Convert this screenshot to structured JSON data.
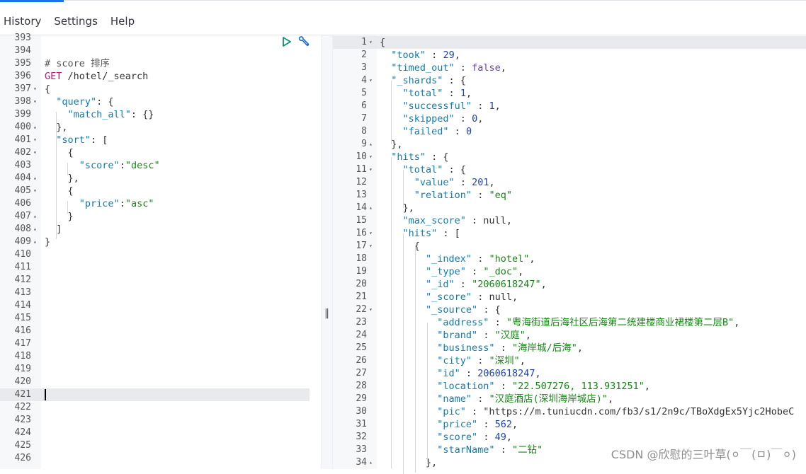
{
  "menu": {
    "history": "History",
    "settings": "Settings",
    "help": "Help"
  },
  "left_editor": {
    "lines": [
      {
        "n": "393",
        "text": ""
      },
      {
        "n": "394",
        "text": ""
      },
      {
        "n": "395",
        "text": "# score 排序"
      },
      {
        "n": "396",
        "text": "GET /hotel/_search"
      },
      {
        "n": "397",
        "text": "{",
        "fold": "▾"
      },
      {
        "n": "398",
        "text": "  \"query\": {",
        "fold": "▾"
      },
      {
        "n": "399",
        "text": "    \"match_all\": {}"
      },
      {
        "n": "400",
        "text": "  },",
        "fold": "▴"
      },
      {
        "n": "401",
        "text": "  \"sort\": [",
        "fold": "▾"
      },
      {
        "n": "402",
        "text": "    {",
        "fold": "▾"
      },
      {
        "n": "403",
        "text": "      \"score\":\"desc\""
      },
      {
        "n": "404",
        "text": "    },",
        "fold": "▴"
      },
      {
        "n": "405",
        "text": "    {",
        "fold": "▾"
      },
      {
        "n": "406",
        "text": "      \"price\":\"asc\""
      },
      {
        "n": "407",
        "text": "    }",
        "fold": "▴"
      },
      {
        "n": "408",
        "text": "  ]",
        "fold": "▴"
      },
      {
        "n": "409",
        "text": "}",
        "fold": "▴"
      },
      {
        "n": "410",
        "text": ""
      },
      {
        "n": "411",
        "text": ""
      },
      {
        "n": "412",
        "text": ""
      },
      {
        "n": "413",
        "text": ""
      },
      {
        "n": "414",
        "text": ""
      },
      {
        "n": "415",
        "text": ""
      },
      {
        "n": "416",
        "text": ""
      },
      {
        "n": "417",
        "text": ""
      },
      {
        "n": "418",
        "text": ""
      },
      {
        "n": "419",
        "text": ""
      },
      {
        "n": "420",
        "text": ""
      },
      {
        "n": "421",
        "text": ""
      },
      {
        "n": "422",
        "text": ""
      },
      {
        "n": "423",
        "text": ""
      },
      {
        "n": "424",
        "text": ""
      },
      {
        "n": "425",
        "text": ""
      },
      {
        "n": "426",
        "text": ""
      }
    ]
  },
  "right_editor": {
    "lines": [
      {
        "n": "1",
        "text": "{",
        "fold": "▾"
      },
      {
        "n": "2",
        "text": "  \"took\" : 29,"
      },
      {
        "n": "3",
        "text": "  \"timed_out\" : false,"
      },
      {
        "n": "4",
        "text": "  \"_shards\" : {",
        "fold": "▾"
      },
      {
        "n": "5",
        "text": "    \"total\" : 1,"
      },
      {
        "n": "6",
        "text": "    \"successful\" : 1,"
      },
      {
        "n": "7",
        "text": "    \"skipped\" : 0,"
      },
      {
        "n": "8",
        "text": "    \"failed\" : 0"
      },
      {
        "n": "9",
        "text": "  },",
        "fold": "▴"
      },
      {
        "n": "10",
        "text": "  \"hits\" : {",
        "fold": "▾"
      },
      {
        "n": "11",
        "text": "    \"total\" : {",
        "fold": "▾"
      },
      {
        "n": "12",
        "text": "      \"value\" : 201,"
      },
      {
        "n": "13",
        "text": "      \"relation\" : \"eq\""
      },
      {
        "n": "14",
        "text": "    },",
        "fold": "▴"
      },
      {
        "n": "15",
        "text": "    \"max_score\" : null,"
      },
      {
        "n": "16",
        "text": "    \"hits\" : [",
        "fold": "▾"
      },
      {
        "n": "17",
        "text": "      {",
        "fold": "▾"
      },
      {
        "n": "18",
        "text": "        \"_index\" : \"hotel\","
      },
      {
        "n": "19",
        "text": "        \"_type\" : \"_doc\","
      },
      {
        "n": "20",
        "text": "        \"_id\" : \"2060618247\","
      },
      {
        "n": "21",
        "text": "        \"_score\" : null,"
      },
      {
        "n": "22",
        "text": "        \"_source\" : {",
        "fold": "▾"
      },
      {
        "n": "23",
        "text": "          \"address\" : \"粤海街道后海社区后海第二统建楼商业裙楼第二层B\","
      },
      {
        "n": "24",
        "text": "          \"brand\" : \"汉庭\","
      },
      {
        "n": "25",
        "text": "          \"business\" : \"海岸城/后海\","
      },
      {
        "n": "26",
        "text": "          \"city\" : \"深圳\","
      },
      {
        "n": "27",
        "text": "          \"id\" : 2060618247,"
      },
      {
        "n": "28",
        "text": "          \"location\" : \"22.507276, 113.931251\","
      },
      {
        "n": "29",
        "text": "          \"name\" : \"汉庭酒店(深圳海岸城店)\","
      },
      {
        "n": "30",
        "text": "          \"pic\" : \"https://m.tuniucdn.com/fb3/s1/2n9c/TBoXdgEx5Yjc2HobeC"
      },
      {
        "n": "31",
        "text": "          \"price\" : 562,"
      },
      {
        "n": "32",
        "text": "          \"score\" : 49,"
      },
      {
        "n": "33",
        "text": "          \"starName\" : \"二钻\""
      },
      {
        "n": "34",
        "text": "        },",
        "fold": "▴"
      }
    ]
  },
  "splitter_grip": "‖",
  "watermark": "CSDN @欣慰的三叶草(⚪￣(ㅁ)￣⚪)"
}
